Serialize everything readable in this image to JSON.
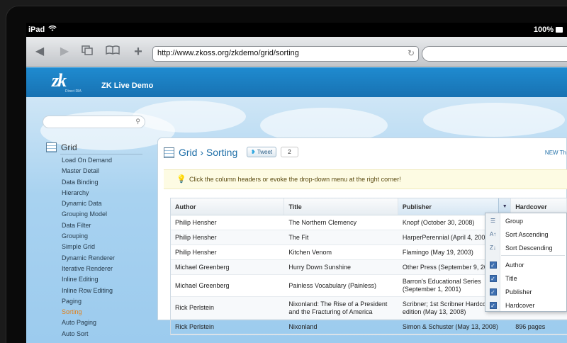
{
  "device": {
    "name": "iPad",
    "battery": "100%"
  },
  "browser": {
    "url": "http://www.zkoss.org/zkdemo/grid/sorting"
  },
  "app": {
    "logo": "zk",
    "logo_sub": "Direct RIA",
    "title": "ZK Live Demo"
  },
  "sidebar": {
    "category": "Grid",
    "items": [
      "Load On Demand",
      "Master Detail",
      "Data Binding",
      "Hierarchy",
      "Dynamic Data",
      "Grouping Model",
      "Data Filter",
      "Grouping",
      "Simple Grid",
      "Dynamic Renderer",
      "Iterative Renderer",
      "Inline Editing",
      "Inline Row Editing",
      "Paging",
      "Sorting",
      "Auto Paging",
      "Auto Sort"
    ],
    "active": "Sorting"
  },
  "panel": {
    "title": "Grid › Sorting",
    "tweet_label": "Tweet",
    "tweet_count": "2",
    "new_badge": "NEW Th",
    "tip": "Click the column headers or evoke the drop-down menu at the right corner!"
  },
  "grid": {
    "columns": [
      "Author",
      "Title",
      "Publisher",
      "Hardcover"
    ],
    "rows": [
      [
        "Philip Hensher",
        "The Northern Clemency",
        "Knopf (October 30, 2008)",
        ""
      ],
      [
        "Philip Hensher",
        "The Fit",
        "HarperPerennial (April 4, 2002)",
        ""
      ],
      [
        "Philip Hensher",
        "Kitchen Venom",
        "Flamingo (May 19, 2003)",
        ""
      ],
      [
        "Michael Greenberg",
        "Hurry Down Sunshine",
        "Other Press (September 9, 2008)",
        ""
      ],
      [
        "Michael Greenberg",
        "Painless Vocabulary (Painless)",
        "Barron's Educational Series (September 1, 2001)",
        ""
      ],
      [
        "Rick Perlstein",
        "Nixonland: The Rise of a President and the Fracturing of America",
        "Scribner; 1st Scribner Hardcover edition (May 13, 2008)",
        ""
      ],
      [
        "Rick Perlstein",
        "Nixonland",
        "Simon & Schuster (May 13, 2008)",
        "896 pages"
      ]
    ]
  },
  "column_menu": {
    "group": "Group",
    "sort_asc": "Sort Ascending",
    "sort_desc": "Sort Descending",
    "columns": [
      "Author",
      "Title",
      "Publisher",
      "Hardcover"
    ]
  }
}
